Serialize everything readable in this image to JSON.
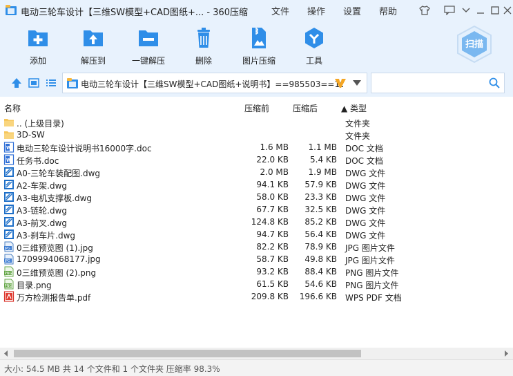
{
  "window": {
    "title": "电动三轮车设计【三维SW模型+CAD图纸+... - 360压缩",
    "menu": [
      "文件",
      "操作",
      "设置",
      "帮助"
    ]
  },
  "toolbar": {
    "items": [
      "添加",
      "解压到",
      "一键解压",
      "删除",
      "图片压缩",
      "工具"
    ],
    "scan_label": "扫描"
  },
  "address": {
    "path": "电动三轮车设计【三维SW模型+CAD图纸+说明书】==985503==10"
  },
  "search": {
    "placeholder": ""
  },
  "columns": {
    "name": "名称",
    "size_before": "压缩前",
    "size_after": "压缩后",
    "type": "▲ 类型"
  },
  "files": [
    {
      "name": ".. (上级目录)",
      "size1": "",
      "size2": "",
      "type": "文件夹",
      "icon": "folder-icon"
    },
    {
      "name": "3D-SW",
      "size1": "",
      "size2": "",
      "type": "文件夹",
      "icon": "folder-icon"
    },
    {
      "name": "电动三轮车设计说明书16000字.doc",
      "size1": "1.6 MB",
      "size2": "1.1 MB",
      "type": "DOC 文档",
      "icon": "doc-icon"
    },
    {
      "name": "任务书.doc",
      "size1": "22.0 KB",
      "size2": "5.4 KB",
      "type": "DOC 文档",
      "icon": "doc-icon"
    },
    {
      "name": "A0-三轮车装配图.dwg",
      "size1": "2.0 MB",
      "size2": "1.9 MB",
      "type": "DWG 文件",
      "icon": "dwg-icon"
    },
    {
      "name": "A2-车架.dwg",
      "size1": "94.1 KB",
      "size2": "57.9 KB",
      "type": "DWG 文件",
      "icon": "dwg-icon"
    },
    {
      "name": "A3-电机支撑板.dwg",
      "size1": "58.0 KB",
      "size2": "23.3 KB",
      "type": "DWG 文件",
      "icon": "dwg-icon"
    },
    {
      "name": "A3-链轮.dwg",
      "size1": "67.7 KB",
      "size2": "32.5 KB",
      "type": "DWG 文件",
      "icon": "dwg-icon"
    },
    {
      "name": "A3-前叉.dwg",
      "size1": "124.8 KB",
      "size2": "85.2 KB",
      "type": "DWG 文件",
      "icon": "dwg-icon"
    },
    {
      "name": "A3-刹车片.dwg",
      "size1": "94.7 KB",
      "size2": "56.4 KB",
      "type": "DWG 文件",
      "icon": "dwg-icon"
    },
    {
      "name": "0三维预览图 (1).jpg",
      "size1": "82.2 KB",
      "size2": "78.9 KB",
      "type": "JPG 图片文件",
      "icon": "jpg-icon"
    },
    {
      "name": "1709994068177.jpg",
      "size1": "58.7 KB",
      "size2": "49.8 KB",
      "type": "JPG 图片文件",
      "icon": "jpg-icon"
    },
    {
      "name": "0三维预览图 (2).png",
      "size1": "93.2 KB",
      "size2": "88.4 KB",
      "type": "PNG 图片文件",
      "icon": "png-icon"
    },
    {
      "name": "目录.png",
      "size1": "61.5 KB",
      "size2": "54.6 KB",
      "type": "PNG 图片文件",
      "icon": "png-icon"
    },
    {
      "name": "万方检测报告单.pdf",
      "size1": "209.8 KB",
      "size2": "196.6 KB",
      "type": "WPS PDF 文档",
      "icon": "pdf-icon"
    }
  ],
  "status": "大小: 54.5 MB 共 14 个文件和 1 个文件夹 压缩率 98.3%",
  "colors": {
    "accent": "#2f8ee8",
    "toolbar_bg": "#e8f2fd",
    "address_mark": "#f5a623"
  }
}
